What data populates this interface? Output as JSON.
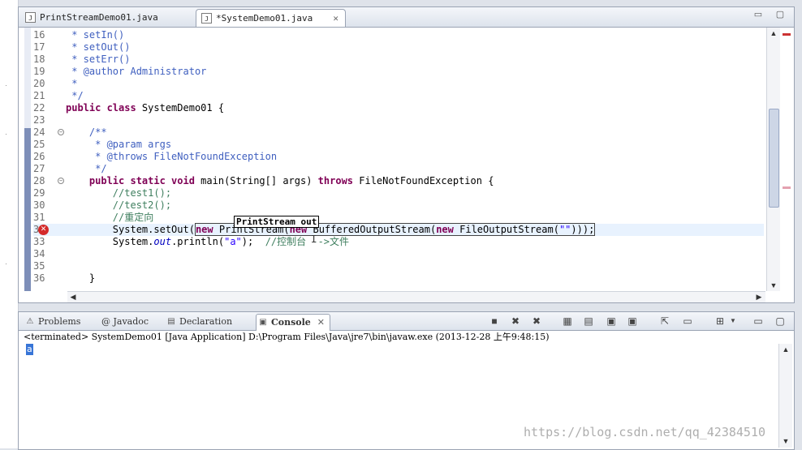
{
  "editor": {
    "tabs": [
      {
        "label": "PrintStreamDemo01.java",
        "active": false
      },
      {
        "label": "*SystemDemo01.java",
        "active": true
      }
    ],
    "tab_close_glyph": "✕",
    "tooltip": "PrintStream out",
    "lines": [
      {
        "n": "16",
        "text": " * setIn()"
      },
      {
        "n": "17",
        "text": " * setOut()"
      },
      {
        "n": "18",
        "text": " * setErr()"
      },
      {
        "n": "19",
        "text": " * @author Administrator"
      },
      {
        "n": "20",
        "text": " *"
      },
      {
        "n": "21",
        "text": " */"
      },
      {
        "n": "22",
        "kw": "public class",
        "text": " SystemDemo01 {"
      },
      {
        "n": "23",
        "text": ""
      },
      {
        "n": "24",
        "text": "    /**"
      },
      {
        "n": "25",
        "text": "     * @param args"
      },
      {
        "n": "26",
        "text": "     * @throws FileNotFoundException"
      },
      {
        "n": "27",
        "text": "     */"
      },
      {
        "n": "28",
        "a": "    ",
        "kw": "public static void",
        "b": " main(String[] args) ",
        "kw2": "throws",
        "c": " FileNotFoundException {"
      },
      {
        "n": "29",
        "text": "        //test1();"
      },
      {
        "n": "30",
        "text": "        //test2();"
      },
      {
        "n": "31",
        "text": "        //重定向"
      },
      {
        "n": "32",
        "a": "        System.setOut(",
        "k1": "new",
        "b": " PrintStream(",
        "k2": "new",
        "c": " BufferedOutputStream(",
        "k3": "new",
        "d": " FileOutputStream(",
        "s": "\"\"",
        "e": ")));"
      },
      {
        "n": "33",
        "a": "        System.",
        "it": "out",
        "b": ".println(",
        "s": "\"a\"",
        "c": ");  ",
        "cm": "//控制台 -->文件"
      },
      {
        "n": "34",
        "text": ""
      },
      {
        "n": "35",
        "text": ""
      },
      {
        "n": "36",
        "text": "    }"
      }
    ]
  },
  "panel": {
    "tabs": [
      {
        "label": "Problems",
        "icon": "problems-icon"
      },
      {
        "label": "@ Javadoc",
        "icon": "javadoc-icon"
      },
      {
        "label": "Declaration",
        "icon": "declaration-icon"
      },
      {
        "label": "Console",
        "icon": "console-icon"
      }
    ],
    "terminated_line": "<terminated> SystemDemo01 [Java Application] D:\\Program Files\\Java\\jre7\\bin\\javaw.exe (2013-12-28 上午9:48:15)",
    "output": "a"
  },
  "watermark": "https://blog.csdn.net/qq_42384510",
  "colors": {
    "keyword": "#7f0055",
    "comment": "#3f5fbf",
    "string": "#2a00ff",
    "selection": "#3875d7"
  }
}
